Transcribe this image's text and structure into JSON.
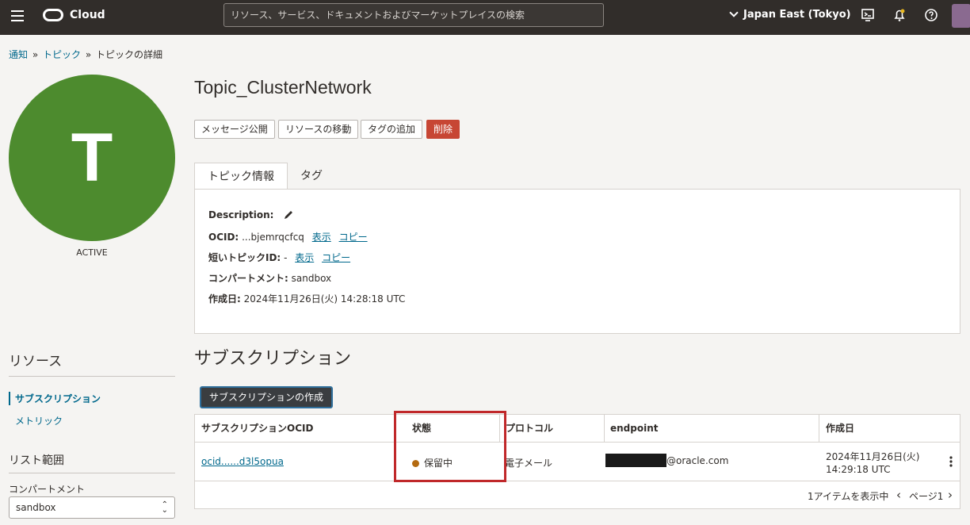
{
  "topbar": {
    "brand": "Cloud",
    "search_placeholder": "リソース、サービス、ドキュメントおよびマーケットプレイスの検索",
    "region": "Japan East (Tokyo)"
  },
  "breadcrumb": {
    "items": [
      "通知",
      "トピック",
      "トピックの詳細"
    ]
  },
  "resource": {
    "initial": "T",
    "state": "ACTIVE",
    "title": "Topic_ClusterNetwork"
  },
  "actions": {
    "publish": "メッセージ公開",
    "move": "リソースの移動",
    "add_tag": "タグの追加",
    "delete": "削除"
  },
  "tabs": {
    "info": "トピック情報",
    "tags": "タグ"
  },
  "info": {
    "description_label": "Description:",
    "ocid_label": "OCID:",
    "ocid_value": "...bjemrqcfcq",
    "show": "表示",
    "copy": "コピー",
    "short_id_label": "短いトピックID:",
    "short_id_value": "-",
    "compartment_label": "コンパートメント:",
    "compartment_value": "sandbox",
    "created_label": "作成日:",
    "created_value": "2024年11月26日(火) 14:28:18 UTC"
  },
  "subscriptions": {
    "title": "サブスクリプション",
    "create_button": "サブスクリプションの作成",
    "columns": [
      "サブスクリプションOCID",
      "状態",
      "プロトコル",
      "endpoint",
      "作成日"
    ],
    "rows": [
      {
        "ocid": "ocid......d3l5opua",
        "state": "保留中",
        "protocol": "電子メール",
        "endpoint_suffix": "@oracle.com",
        "created_date": "2024年11月26日(火)",
        "created_time": "14:29:18 UTC"
      }
    ],
    "footer_count": "1アイテムを表示中",
    "page_label": "ページ1",
    "state_color": "#b36a11"
  },
  "sidebar": {
    "resources_title": "リソース",
    "items": [
      "サブスクリプション",
      "メトリック"
    ],
    "list_scope_title": "リスト範囲",
    "compartment_label": "コンパートメント",
    "compartment_value": "sandbox"
  }
}
